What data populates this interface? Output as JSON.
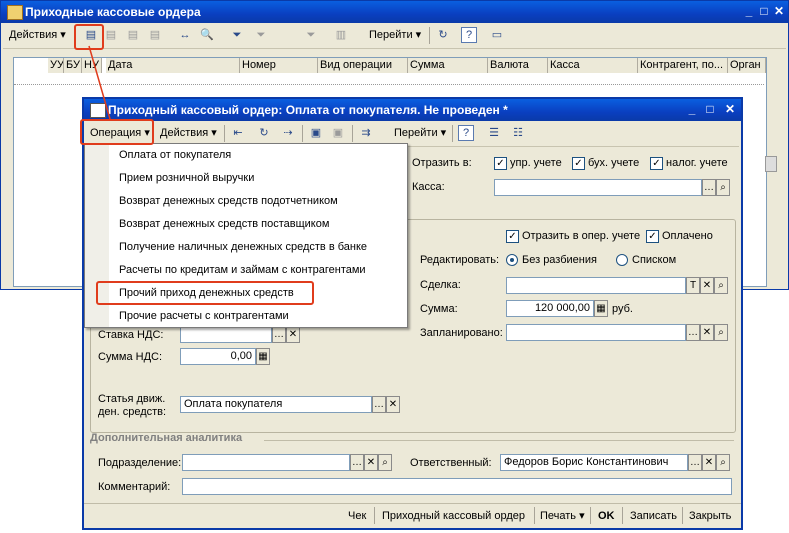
{
  "back_window": {
    "title": "Приходные кассовые ордера",
    "toolbar": {
      "actions": "Действия",
      "goto": "Перейти"
    },
    "columns": [
      "УУ",
      "БУ",
      "НУ",
      "Дата",
      "Номер",
      "Вид операции",
      "Сумма",
      "Валюта",
      "Касса",
      "Контрагент, по...",
      "Орган"
    ]
  },
  "dialog": {
    "title": "Приходный кассовый ордер: Оплата от покупателя. Не проведен *",
    "toolbar": {
      "operation": "Операция",
      "actions": "Действия",
      "goto": "Перейти"
    },
    "reflect_in": {
      "label": "Отразить в:",
      "upr": "упр. учете",
      "buh": "бух. учете",
      "nalog": "налог. учете"
    },
    "kassa_label": "Касса:",
    "reflect_oper": "Отразить в опер. учете",
    "paid": "Оплачено",
    "edit_label": "Редактировать:",
    "edit_opt1": "Без разбиения",
    "edit_opt2": "Списком",
    "deal_label": "Сделка:",
    "sum_label": "Сумма:",
    "sum_value": "120 000,00",
    "currency": "руб.",
    "planned_label": "Запланировано:",
    "vat_rate_label": "Ставка НДС:",
    "vat_sum_label": "Сумма НДС:",
    "vat_sum_value": "0,00",
    "cashflow_label_1": "Статья движ.",
    "cashflow_label_2": "ден. средств:",
    "cashflow_value": "Оплата покупателя",
    "extra_section": "Дополнительная аналитика",
    "dept_label": "Подразделение:",
    "responsible_label": "Ответственный:",
    "responsible_value": "Федоров Борис Константинович",
    "comment_label": "Комментарий:",
    "footer": {
      "check": "Чек",
      "pko": "Приходный кассовый ордер",
      "print": "Печать",
      "ok": "OK",
      "save": "Записать",
      "close": "Закрыть"
    }
  },
  "operation_menu": {
    "items": [
      "Оплата от покупателя",
      "Прием розничной выручки",
      "Возврат денежных средств подотчетником",
      "Возврат денежных средств поставщиком",
      "Получение наличных денежных средств в банке",
      "Расчеты по кредитам и займам с контрагентами",
      "Прочий приход денежных средств",
      "Прочие расчеты с контрагентами"
    ]
  },
  "colors": {
    "title_bar": "#0a4fd0",
    "window_bg": "#ece9d8",
    "highlight": "#e03c1c"
  }
}
